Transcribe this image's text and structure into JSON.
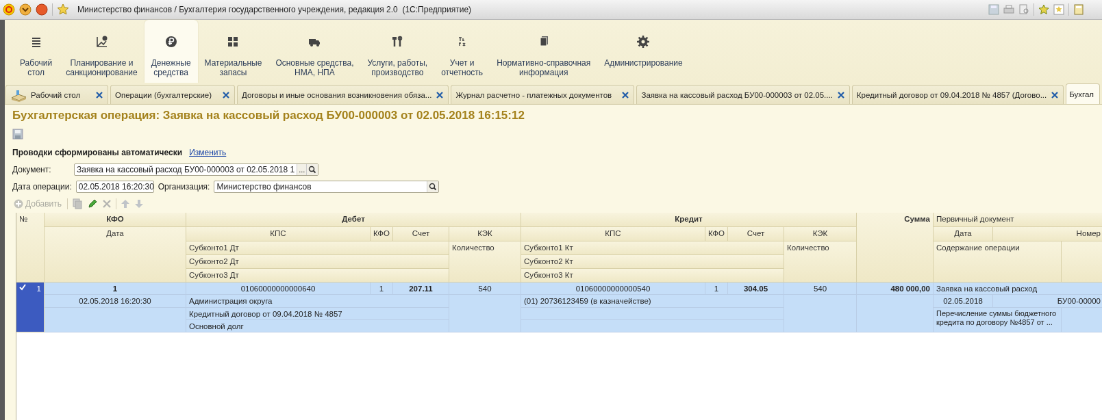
{
  "window": {
    "title": "Министерство финансов / Бухгалтерия государственного учреждения, редакция 2.0  (1С:Предприятие)"
  },
  "sections": [
    {
      "label": "Рабочий\nстол",
      "selected": false
    },
    {
      "label": "Планирование и\nсанкционирование",
      "selected": false
    },
    {
      "label": "Денежные\nсредства",
      "selected": true
    },
    {
      "label": "Материальные\nзапасы",
      "selected": false
    },
    {
      "label": "Основные средства,\nНМА, НПА",
      "selected": false
    },
    {
      "label": "Услуги, работы,\nпроизводство",
      "selected": false
    },
    {
      "label": "Учет и\nотчетность",
      "selected": false
    },
    {
      "label": "Нормативно-справочная\nинформация",
      "selected": false
    },
    {
      "label": "Администрирование",
      "selected": false
    }
  ],
  "tabs": [
    {
      "label": "Рабочий стол",
      "selected": false,
      "closable": true
    },
    {
      "label": "Операции (бухгалтерские)",
      "selected": false,
      "closable": true
    },
    {
      "label": "Договоры и иные основания возникновения обяза...",
      "selected": false,
      "closable": true
    },
    {
      "label": "Журнал расчетно - платежных документов",
      "selected": false,
      "closable": true
    },
    {
      "label": "Заявка на кассовый расход БУ00-000003 от 02.05....",
      "selected": false,
      "closable": true
    },
    {
      "label": "Кредитный договор от 09.04.2018 № 4857 (Догово...",
      "selected": false,
      "closable": true
    },
    {
      "label": "Бухгал",
      "selected": true,
      "closable": false
    }
  ],
  "form": {
    "title": "Бухгалтерская операция: Заявка на кассовый расход БУ00-000003 от 02.05.2018 16:15:12",
    "posting_status": {
      "text": "Проводки сформированы автоматически",
      "link": "Изменить"
    },
    "document": {
      "label": "Документ:",
      "value": "Заявка на кассовый расход БУ00-000003 от 02.05.2018 1",
      "button": "..."
    },
    "operation_date": {
      "label": "Дата операции:",
      "value": "02.05.2018 16:20:30"
    },
    "organization": {
      "label": "Организация:",
      "value": "Министерство финансов"
    },
    "toolbar": {
      "add": {
        "label": "Добавить",
        "disabled": true
      }
    }
  },
  "table": {
    "header": {
      "number": "№",
      "kfo": "КФО",
      "date": "Дата",
      "debit": {
        "title": "Дебет",
        "kps": "КПС",
        "kfo": "КФО",
        "account": "Счет",
        "kek": "КЭК",
        "quantity": "Количество",
        "subconto": [
          "Субконто1 Дт",
          "Субконто2 Дт",
          "Субконто3 Дт"
        ]
      },
      "credit": {
        "title": "Кредит",
        "kps": "КПС",
        "kfo": "КФО",
        "account": "Счет",
        "kek": "КЭК",
        "quantity": "Количество",
        "subconto": [
          "Субконто1 Кт",
          "Субконто2 Кт",
          "Субконто3 Кт"
        ]
      },
      "sum": "Сумма",
      "primary": {
        "title": "Первичный документ",
        "date": "Дата",
        "number": "Номер",
        "content": "Содержание операции"
      }
    },
    "rows": [
      {
        "selected": true,
        "active": true,
        "number": "1",
        "kfo": "1",
        "date": "02.05.2018 16:20:30",
        "debit": {
          "kps": "01060000000000640",
          "kfo": "1",
          "account": "207.11",
          "kek": "540",
          "subconto": [
            "Администрация округа",
            "Кредитный договор от 09.04.2018 № 4857",
            "Основной долг"
          ]
        },
        "credit": {
          "kps": "01060000000000540",
          "kfo": "1",
          "account": "304.05",
          "kek": "540",
          "subconto": [
            "(01) 20736123459 (в казначействе)"
          ]
        },
        "sum": "480 000,00",
        "primary": {
          "document": "Заявка на кассовый расход",
          "date": "02.05.2018",
          "number": "БУ00-00000",
          "content": "Перечисление суммы бюджетного кредита по договору №4857 от ..."
        }
      }
    ]
  }
}
